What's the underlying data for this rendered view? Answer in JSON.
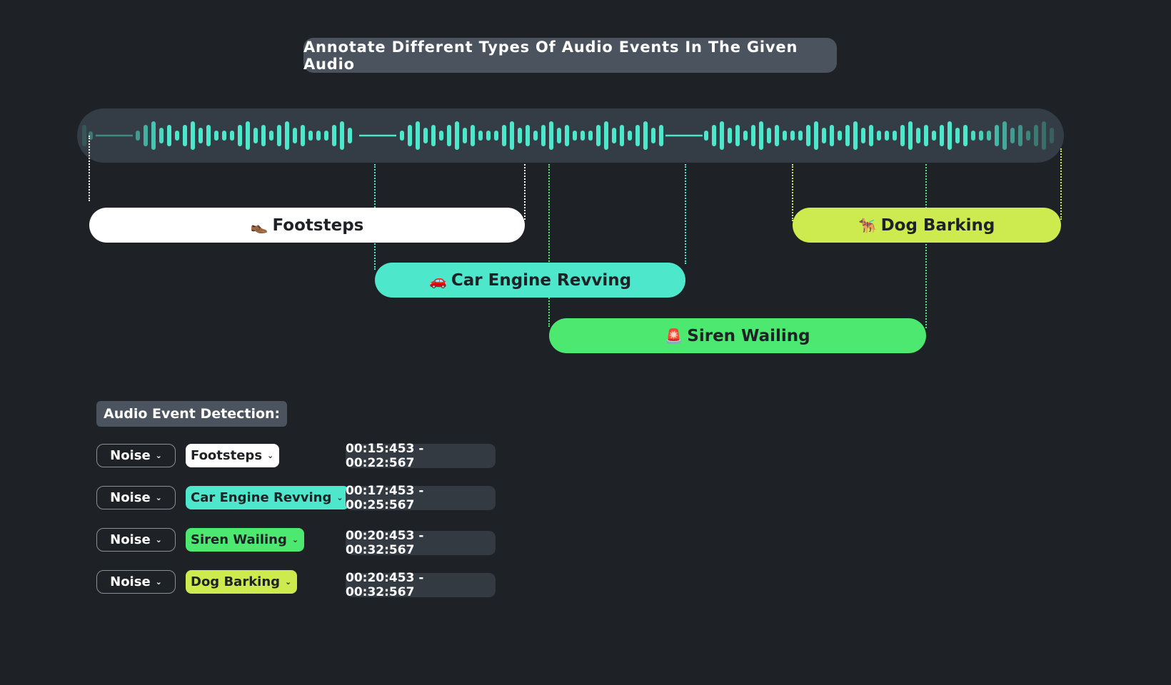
{
  "header": {
    "title": "Annotate Different Types Of Audio Events In The Given Audio"
  },
  "waveform": {
    "color": "#4de8cc"
  },
  "events": [
    {
      "id": "footsteps",
      "emoji": "👞",
      "label": "Footsteps",
      "color": "#ffffff",
      "guide_color": "#ffffff"
    },
    {
      "id": "car",
      "emoji": "🚗",
      "label": "Car Engine Revving",
      "color": "#4de8cc",
      "guide_color": "#4de8cc"
    },
    {
      "id": "siren",
      "emoji": "🚨",
      "label": "Siren Wailing",
      "color": "#4de870",
      "guide_color": "#4de870"
    },
    {
      "id": "dog",
      "emoji": "🐕‍🦺",
      "label": "Dog Barking",
      "color": "#cdea4e",
      "guide_color": "#cdea4e"
    }
  ],
  "detection": {
    "heading": "Audio Event Detection:",
    "rows": [
      {
        "category": "Noise",
        "label": "Footsteps",
        "color": "#ffffff",
        "time": "00:15:453 - 00:22:567"
      },
      {
        "category": "Noise",
        "label": "Car Engine Revving",
        "color": "#4de8cc",
        "time": "00:17:453 - 00:25:567"
      },
      {
        "category": "Noise",
        "label": "Siren Wailing",
        "color": "#4de870",
        "time": "00:20:453 - 00:32:567"
      },
      {
        "category": "Noise",
        "label": "Dog Barking",
        "color": "#cdea4e",
        "time": "00:20:453 - 00:32:567"
      }
    ],
    "chevron": "⌄"
  }
}
